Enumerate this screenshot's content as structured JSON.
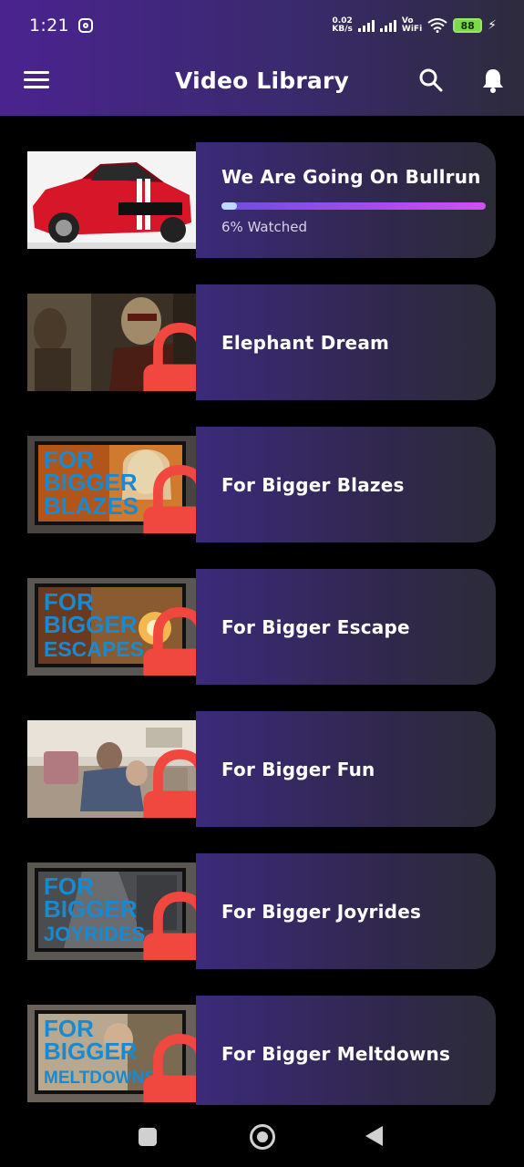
{
  "status_bar": {
    "time": "1:21",
    "net_speed_value": "0.02",
    "net_speed_unit": "KB/s",
    "vowifi_top": "Vo",
    "vowifi_bottom": "WiFi",
    "battery": "88"
  },
  "app_bar": {
    "title": "Video Library",
    "icons": [
      "menu-icon",
      "search-icon",
      "bell-icon"
    ]
  },
  "videos": [
    {
      "title": "We Are Going On Bullrun",
      "locked": false,
      "progress": 0.06,
      "progress_label": "6% Watched"
    },
    {
      "title": "Elephant Dream",
      "locked": true
    },
    {
      "title": "For Bigger Blazes",
      "locked": true
    },
    {
      "title": "For Bigger Escape",
      "locked": true
    },
    {
      "title": "For Bigger Fun",
      "locked": true
    },
    {
      "title": "For Bigger Joyrides",
      "locked": true
    },
    {
      "title": "For Bigger Meltdowns",
      "locked": true
    }
  ],
  "thumbnail_text": {
    "blazes": [
      "FOR",
      "BIGGER",
      "BLAZES"
    ],
    "escape": [
      "FOR",
      "BIGGER",
      "ESCAPES"
    ],
    "joyrides": [
      "FOR",
      "BIGGER",
      "JOYRIDES"
    ],
    "meltdowns": [
      "FOR",
      "BIGGER",
      "MELTDOWNS"
    ]
  },
  "colors": {
    "lock": "#f0473f",
    "card_gradient_start": "#3b2a7a",
    "progress_start": "#6f4fd6",
    "progress_end": "#d24ff2",
    "header_start": "#4a238f"
  },
  "nav_bar": {
    "icons": [
      "recents-square-icon",
      "home-circle-icon",
      "back-triangle-icon"
    ]
  }
}
